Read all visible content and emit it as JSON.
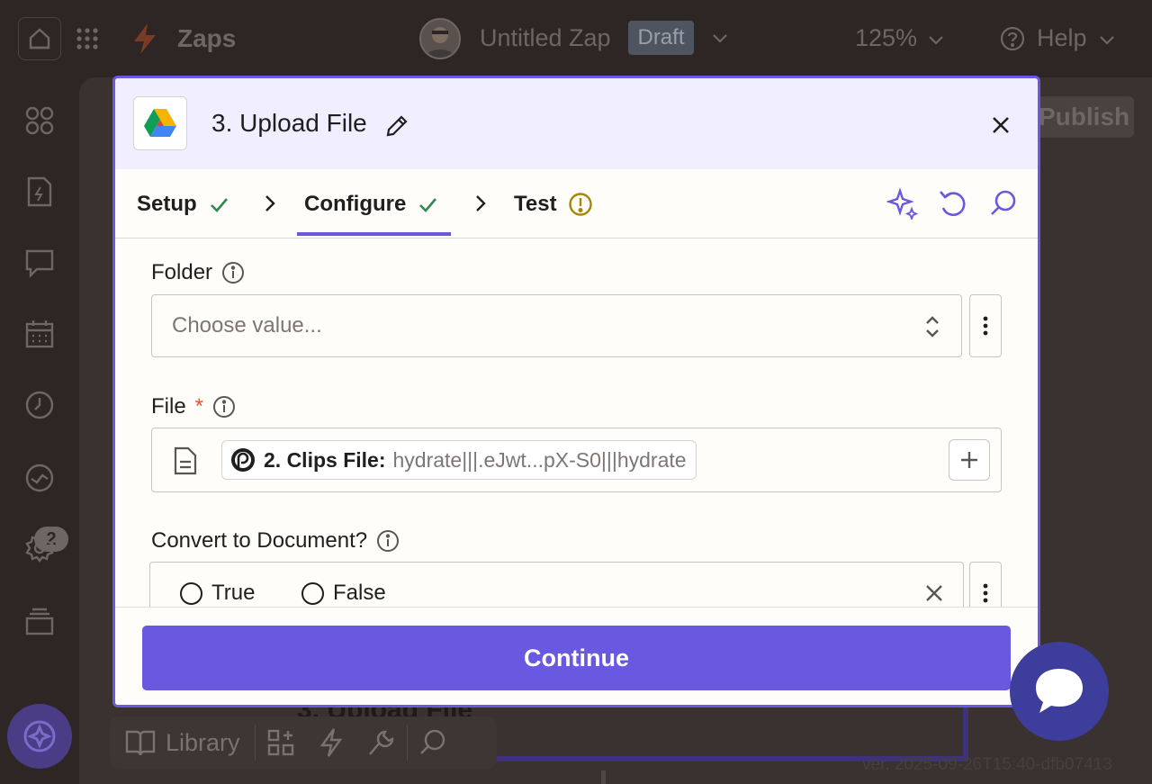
{
  "topbar": {
    "app_label": "Zaps",
    "zap_title": "Untitled Zap",
    "draft_badge": "Draft",
    "zoom": "125%",
    "help_label": "Help"
  },
  "sidebar": {
    "notifications_count": "2"
  },
  "canvas": {
    "publish_label": "Publish",
    "background_step_text": "3. Upload File",
    "library_label": "Library",
    "version": "ver. 2025-09-26T15:40-dfb07413"
  },
  "modal": {
    "title": "3. Upload File",
    "tabs": [
      {
        "label": "Setup",
        "status": "complete"
      },
      {
        "label": "Configure",
        "status": "complete"
      },
      {
        "label": "Test",
        "status": "warning"
      }
    ],
    "fields": {
      "folder": {
        "label": "Folder",
        "placeholder": "Choose value..."
      },
      "file": {
        "label": "File",
        "required_marker": "*",
        "pill_step": "2. Clips File:",
        "pill_value": "hydrate|||.eJwt...pX-S0|||hydrate"
      },
      "convert": {
        "label": "Convert to Document?",
        "options": [
          "True",
          "False"
        ]
      }
    },
    "continue_label": "Continue"
  },
  "colors": {
    "accent": "#6958e0",
    "check_green": "#2e8a4a",
    "warning_yellow": "#a8860a",
    "required_red": "#e3542a",
    "chat_fab": "#3d3d9c"
  }
}
